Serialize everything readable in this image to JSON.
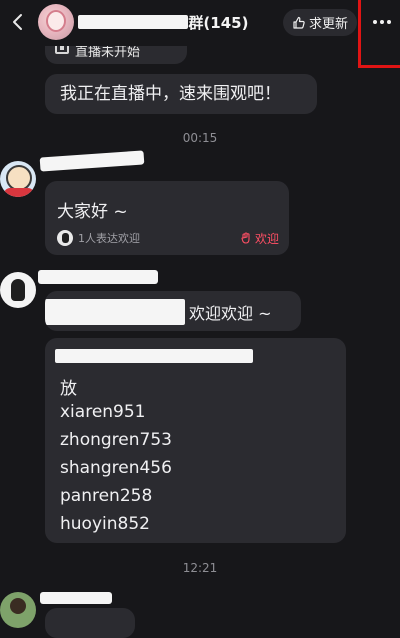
{
  "header": {
    "title": "1群(145)",
    "update_label": "求更新",
    "back_icon": "chevron-left-icon",
    "more_icon": "more-dots-icon"
  },
  "messages": {
    "live_start_text": "直播未开始",
    "live_msg": "我正在直播中，速来围观吧！",
    "time_1": "00:15",
    "hello_text": "大家好 ~",
    "welcome_count": "1人表达欢迎",
    "welcome_button": "欢迎",
    "welcome_msg": "欢迎欢迎 ~",
    "list_lines": [
      "放",
      "xiaren951",
      "zhongren753",
      "shangren456",
      "panren258",
      "huoyin852"
    ],
    "time_2": "12:21"
  },
  "colors": {
    "background": "#17171a",
    "bubble": "#2b2b30",
    "accent_red": "#ff4f64",
    "highlight_box": "#e01414"
  }
}
